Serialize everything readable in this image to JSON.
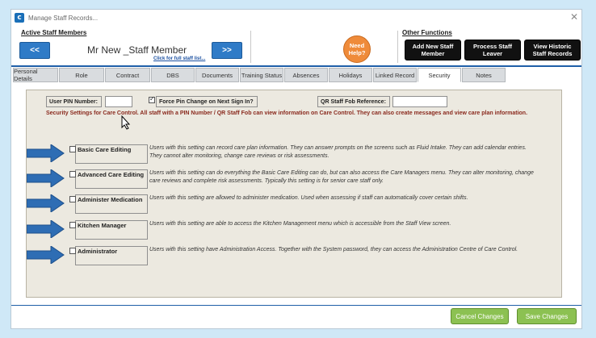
{
  "window": {
    "title": "Manage Staff Records..."
  },
  "header": {
    "active_staff_label": "Active Staff Members",
    "prev_label": "<<",
    "next_label": ">>",
    "staff_name": "Mr New _Staff Member",
    "full_list_link": "Click for full staff list...",
    "need_help": "Need Help?",
    "other_functions_label": "Other Functions",
    "buttons": {
      "add_new": "Add New Staff Member",
      "process_leaver": "Process Staff Leaver",
      "view_historic": "View Historic Staff Records"
    }
  },
  "tabs": [
    {
      "label": "Personal Details",
      "active": false
    },
    {
      "label": "Role",
      "active": false
    },
    {
      "label": "Contract",
      "active": false
    },
    {
      "label": "DBS",
      "active": false
    },
    {
      "label": "Documents",
      "active": false
    },
    {
      "label": "Training Status",
      "active": false
    },
    {
      "label": "Absences",
      "active": false
    },
    {
      "label": "Holidays",
      "active": false
    },
    {
      "label": "Linked Record",
      "active": false
    },
    {
      "label": "Security",
      "active": true
    },
    {
      "label": "Notes",
      "active": false
    }
  ],
  "security": {
    "pin_label": "User PIN Number:",
    "pin_value": "",
    "force_pin_label": "Force Pin Change on Next Sign In?",
    "force_pin_checked": true,
    "qr_label": "QR Staff Fob Reference:",
    "qr_value": "",
    "note": "Security Settings for Care Control.  All staff with a PIN Number / QR Staff Fob can view information on Care Control.  They can also create messages and view care plan information."
  },
  "permissions": [
    {
      "label": "Basic Care Editing",
      "checked": false,
      "description": "Users with this setting can record care plan information.  They can answer prompts on the screens such as Fluid Intake.  They can add calendar entries.  They cannot alter monitoring, change care reviews or risk assessments."
    },
    {
      "label": "Advanced Care Editing",
      "checked": false,
      "description": "Users with this setting can do everything the Basic Care Editing can do, but can also access the Care Managers menu.  They can alter monitoring, change care reviews and complete risk assessments.  Typically this setting is for senior care staff only."
    },
    {
      "label": "Administer Medication",
      "checked": false,
      "description": "Users with this setting are allowed to administer medication.  Used when assessing if staff can automatically cover certain shifts."
    },
    {
      "label": "Kitchen Manager",
      "checked": false,
      "description": "Users with this setting are able to access the Kitchen Management menu which is accessible from the Staff View screen."
    },
    {
      "label": "Administrator",
      "checked": false,
      "description": "Users with this setting have Administration Access.  Together with the System password, they can access the Administration Centre of Care Control."
    }
  ],
  "footer": {
    "cancel": "Cancel Changes",
    "save": "Save Changes"
  },
  "colors": {
    "accent_blue": "#2f7bc7",
    "arrow_blue": "#2e6db4",
    "help_orange": "#ef8b3a",
    "note_red": "#8a2a1e",
    "save_green": "#8cc152"
  }
}
